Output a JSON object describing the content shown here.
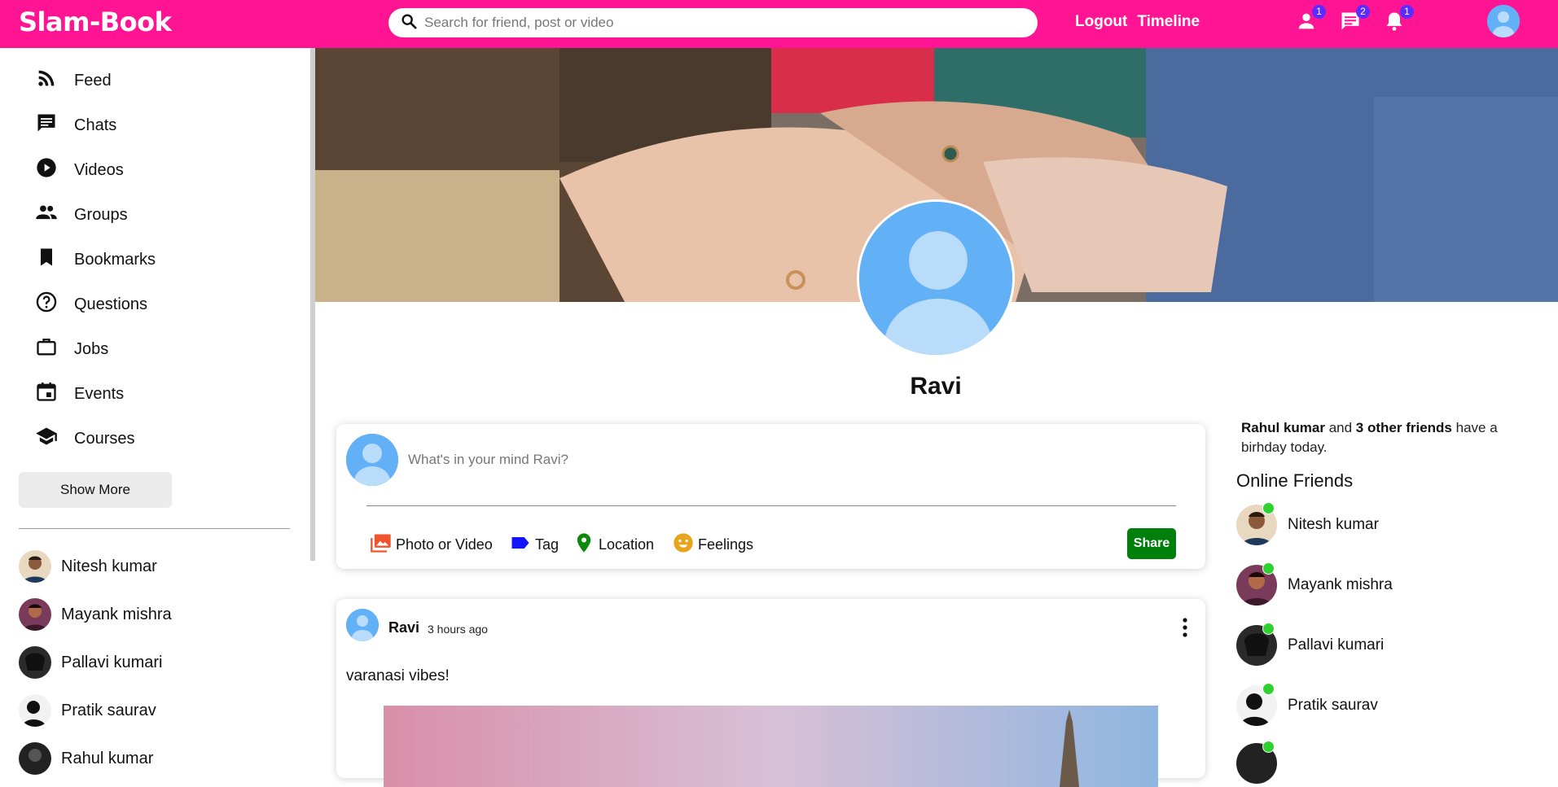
{
  "topbar": {
    "logo": "Slam-Book",
    "search_placeholder": "Search for friend, post or video",
    "links": [
      "Logout",
      "Timeline"
    ],
    "badges": {
      "friends": "1",
      "messages": "2",
      "notifications": "1"
    },
    "color": "#ff1493"
  },
  "sidebar": {
    "items": [
      "Feed",
      "Chats",
      "Videos",
      "Groups",
      "Bookmarks",
      "Questions",
      "Jobs",
      "Events",
      "Courses"
    ],
    "show_more": "Show More",
    "friends": [
      "Nitesh kumar",
      "Mayank mishra",
      "Pallavi kumari",
      "Pratik saurav",
      "Rahul kumar"
    ]
  },
  "profile": {
    "name": "Ravi"
  },
  "composer": {
    "placeholder": "What's in your mind Ravi?",
    "options": [
      "Photo or Video",
      "Tag",
      "Location",
      "Feelings"
    ],
    "share": "Share"
  },
  "post": {
    "author": "Ravi",
    "time": "3 hours ago",
    "text": "varanasi vibes!"
  },
  "rightbar": {
    "birthday_name": "Rahul kumar",
    "birthday_and": " and ",
    "birthday_count": "3 other friends",
    "birthday_rest": " have a birhday today.",
    "online_title": "Online Friends",
    "online": [
      "Nitesh kumar",
      "Mayank mishra",
      "Pallavi kumari",
      "Pratik saurav"
    ]
  }
}
